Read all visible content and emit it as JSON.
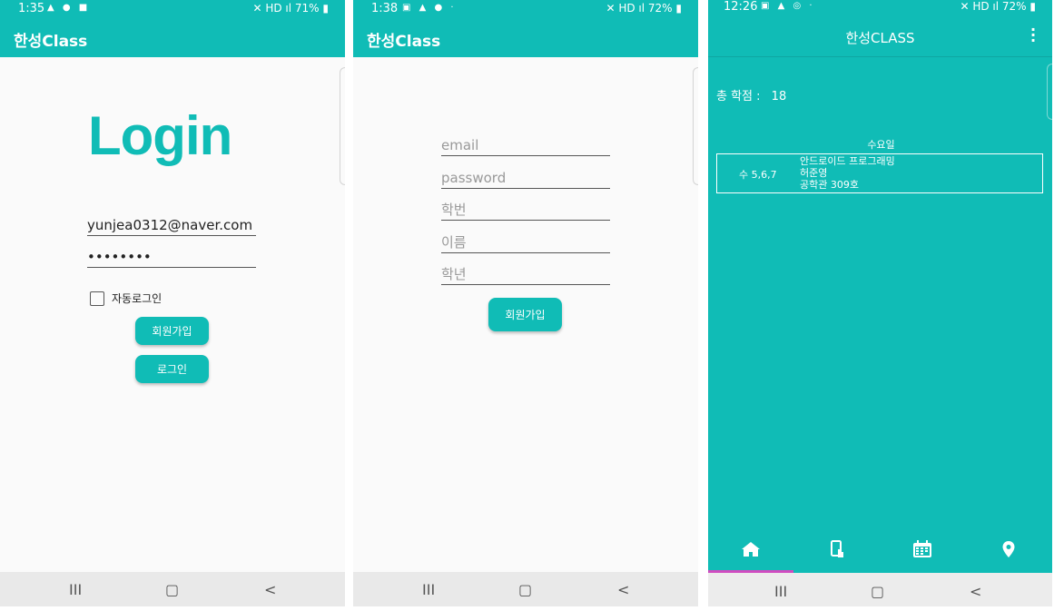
{
  "screens": [
    {
      "status": {
        "time": "1:35",
        "battery": "71%"
      },
      "app_title": "한성Class",
      "logo_text": "Login",
      "email_value": "yunjea0312@naver.com",
      "password_value": "••••••••",
      "auto_login_label": "자동로그인",
      "signup_label": "회원가입",
      "login_label": "로그인"
    },
    {
      "status": {
        "time": "1:38",
        "battery": "72%"
      },
      "app_title": "한성Class",
      "placeholders": {
        "email": "email",
        "password": "password",
        "student_id": "학번",
        "name": "이름",
        "grade": "학년"
      },
      "signup_label": "회원가입"
    },
    {
      "status": {
        "time": "12:26",
        "battery": "72%"
      },
      "app_title": "한성CLASS",
      "total_credits_label": "총 학점 :",
      "total_credits_value": "18",
      "day_title": "수요일",
      "class": {
        "period": "수 5,6,7",
        "name": "안드로이드 프로그래밍",
        "professor": "허준영",
        "room": "공학관 309호"
      },
      "tabs": [
        "home-icon",
        "phone-touch-icon",
        "calendar-icon",
        "location-pin-icon"
      ],
      "selected_tab": 0
    }
  ],
  "navbar": {
    "recent": "III",
    "home": "▢",
    "back": "<"
  },
  "colors": {
    "accent": "#10bcb6",
    "tab_indicator": "#d04cc0"
  }
}
